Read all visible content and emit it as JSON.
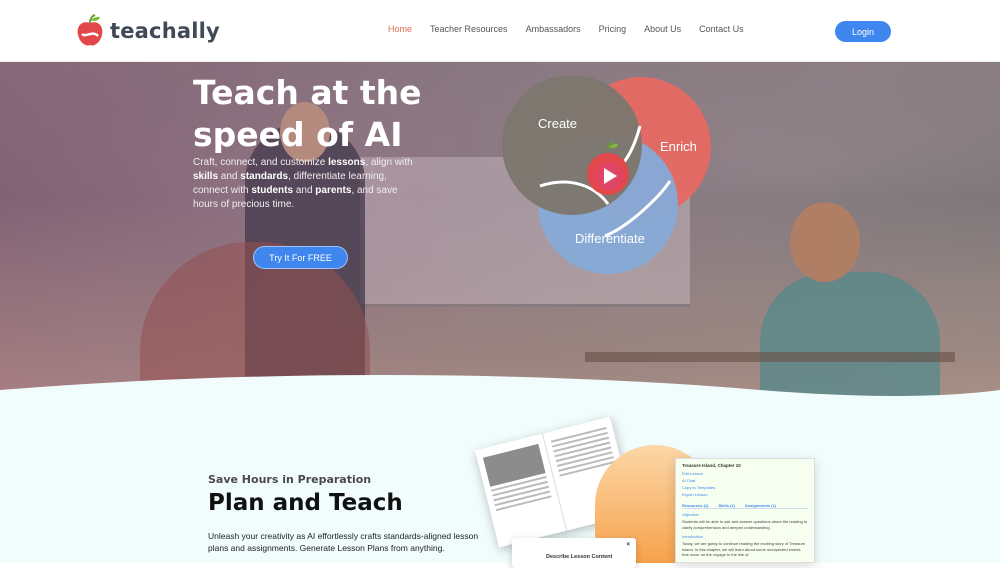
{
  "brand": {
    "name": "teachally"
  },
  "nav": {
    "items": [
      {
        "label": "Home",
        "active": true
      },
      {
        "label": "Teacher Resources",
        "active": false
      },
      {
        "label": "Ambassadors",
        "active": false
      },
      {
        "label": "Pricing",
        "active": false
      },
      {
        "label": "About Us",
        "active": false
      },
      {
        "label": "Contact Us",
        "active": false
      }
    ],
    "login_label": "Login"
  },
  "hero": {
    "title_line1": "Teach at the",
    "title_line2": "speed of AI",
    "cta_label": "Try It For FREE",
    "venn": {
      "create": "Create",
      "enrich": "Enrich",
      "differentiate": "Differentiate"
    }
  },
  "section": {
    "kicker": "Save Hours in Preparation",
    "heading": "Plan and Teach",
    "description": "Unleash your creativity as AI effortlessly crafts standards-aligned lesson plans and assignments. Generate Lesson Plans from anything."
  },
  "preview": {
    "card_title": "Treasure Island, Chapter 10",
    "actions": [
      "Edit Lesson",
      "AI Chat",
      "Copy to Templates",
      "Export Lesson"
    ],
    "tabs": [
      "Resources (1)",
      "Skills (1)",
      "Assignments (1)"
    ],
    "objective_label": "Objective",
    "objective_text": "Students will be able to ask and answer questions about the reading to clarify comprehension and deepen understanding.",
    "intro_label": "Introduction",
    "intro_text": "Today, we are going to continue reading the exciting story of Treasure Island. In this chapter, we will learn about some unexpected events that occur on the voyage to the isle of",
    "modal_title": "Describe Lesson Content",
    "modal_close": "×"
  },
  "colors": {
    "accent": "#3f86ee",
    "brand_red": "#e36b5a",
    "create": "#7d776e",
    "enrich": "#e46a63",
    "differentiate": "#86a9d6"
  }
}
